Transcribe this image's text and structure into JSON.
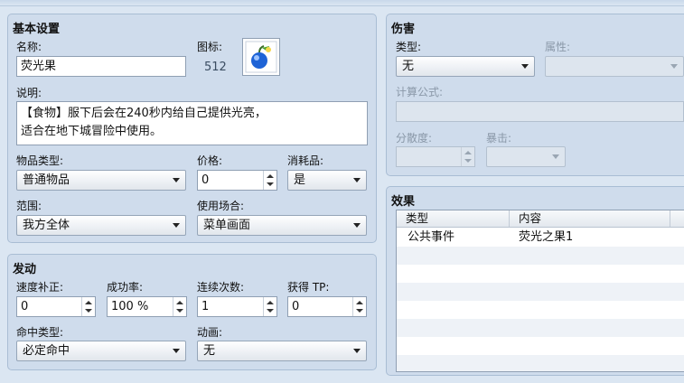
{
  "basic": {
    "title": "基本设置",
    "name_label": "名称:",
    "name_value": "荧光果",
    "icon_label": "图标:",
    "icon_index": "512",
    "desc_label": "说明:",
    "desc_line1": "【食物】服下后会在240秒内给自己提供光亮，",
    "desc_line2": "适合在地下城冒险中使用。",
    "itemtype_label": "物品类型:",
    "itemtype_value": "普通物品",
    "price_label": "价格:",
    "price_value": "0",
    "consumable_label": "消耗品:",
    "consumable_value": "是",
    "scope_label": "范围:",
    "scope_value": "我方全体",
    "occasion_label": "使用场合:",
    "occasion_value": "菜单画面"
  },
  "invocation": {
    "title": "发动",
    "speed_label": "速度补正:",
    "speed_value": "0",
    "success_label": "成功率:",
    "success_value": "100 %",
    "repeat_label": "连续次数:",
    "repeat_value": "1",
    "tp_label": "获得 TP:",
    "tp_value": "0",
    "hittype_label": "命中类型:",
    "hittype_value": "必定命中",
    "animation_label": "动画:",
    "animation_value": "无"
  },
  "damage": {
    "title": "伤害",
    "type_label": "类型:",
    "type_value": "无",
    "element_label": "属性:",
    "element_value": "",
    "formula_label": "计算公式:",
    "formula_value": "",
    "variance_label": "分散度:",
    "variance_value": "",
    "critical_label": "暴击:",
    "critical_value": ""
  },
  "effects": {
    "title": "效果",
    "columns": [
      "类型",
      "内容"
    ],
    "rows": [
      {
        "type": "公共事件",
        "content": "荧光之果1"
      }
    ]
  }
}
